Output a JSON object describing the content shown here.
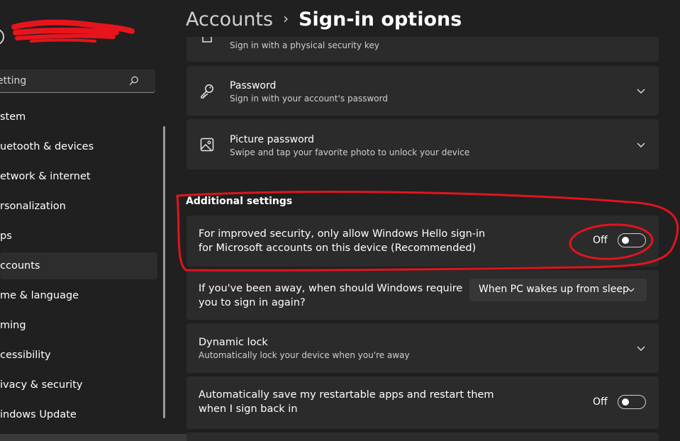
{
  "sidebar": {
    "search": {
      "value": "etting"
    },
    "items": [
      {
        "label": "stem"
      },
      {
        "label": "uetooth & devices"
      },
      {
        "label": "etwork & internet"
      },
      {
        "label": "rsonalization"
      },
      {
        "label": "ps"
      },
      {
        "label": "ccounts",
        "active": true
      },
      {
        "label": "me & language"
      },
      {
        "label": "ming"
      },
      {
        "label": "cessibility"
      },
      {
        "label": "ivacy & security"
      },
      {
        "label": "indows Update"
      }
    ]
  },
  "header": {
    "parent": "Accounts",
    "separator": "›",
    "current": "Sign-in options"
  },
  "cards": {
    "security_key": {
      "desc": "Sign in with a physical security key",
      "icon": "usb-key-icon"
    },
    "password": {
      "title": "Password",
      "desc": "Sign in with your account's password",
      "icon": "key-icon"
    },
    "picture_password": {
      "title": "Picture password",
      "desc": "Swipe and tap your favorite photo to unlock your device",
      "icon": "picture-icon"
    }
  },
  "additional": {
    "heading": "Additional settings",
    "hello_only": {
      "text": "For improved security, only allow Windows Hello sign-in for Microsoft accounts on this device (Recommended)",
      "state": "Off"
    },
    "require_signin": {
      "text": "If you've been away, when should Windows require you to sign in again?",
      "selected": "When PC wakes up from sleep"
    },
    "dynamic_lock": {
      "title": "Dynamic lock",
      "desc": "Automatically lock your device when you're away"
    },
    "restart_apps": {
      "text": "Automatically save my restartable apps and restart them when I sign back in",
      "state": "Off"
    }
  },
  "colors": {
    "background": "#202020",
    "card": "#2b2b2b",
    "annotation": "#e0141e"
  }
}
